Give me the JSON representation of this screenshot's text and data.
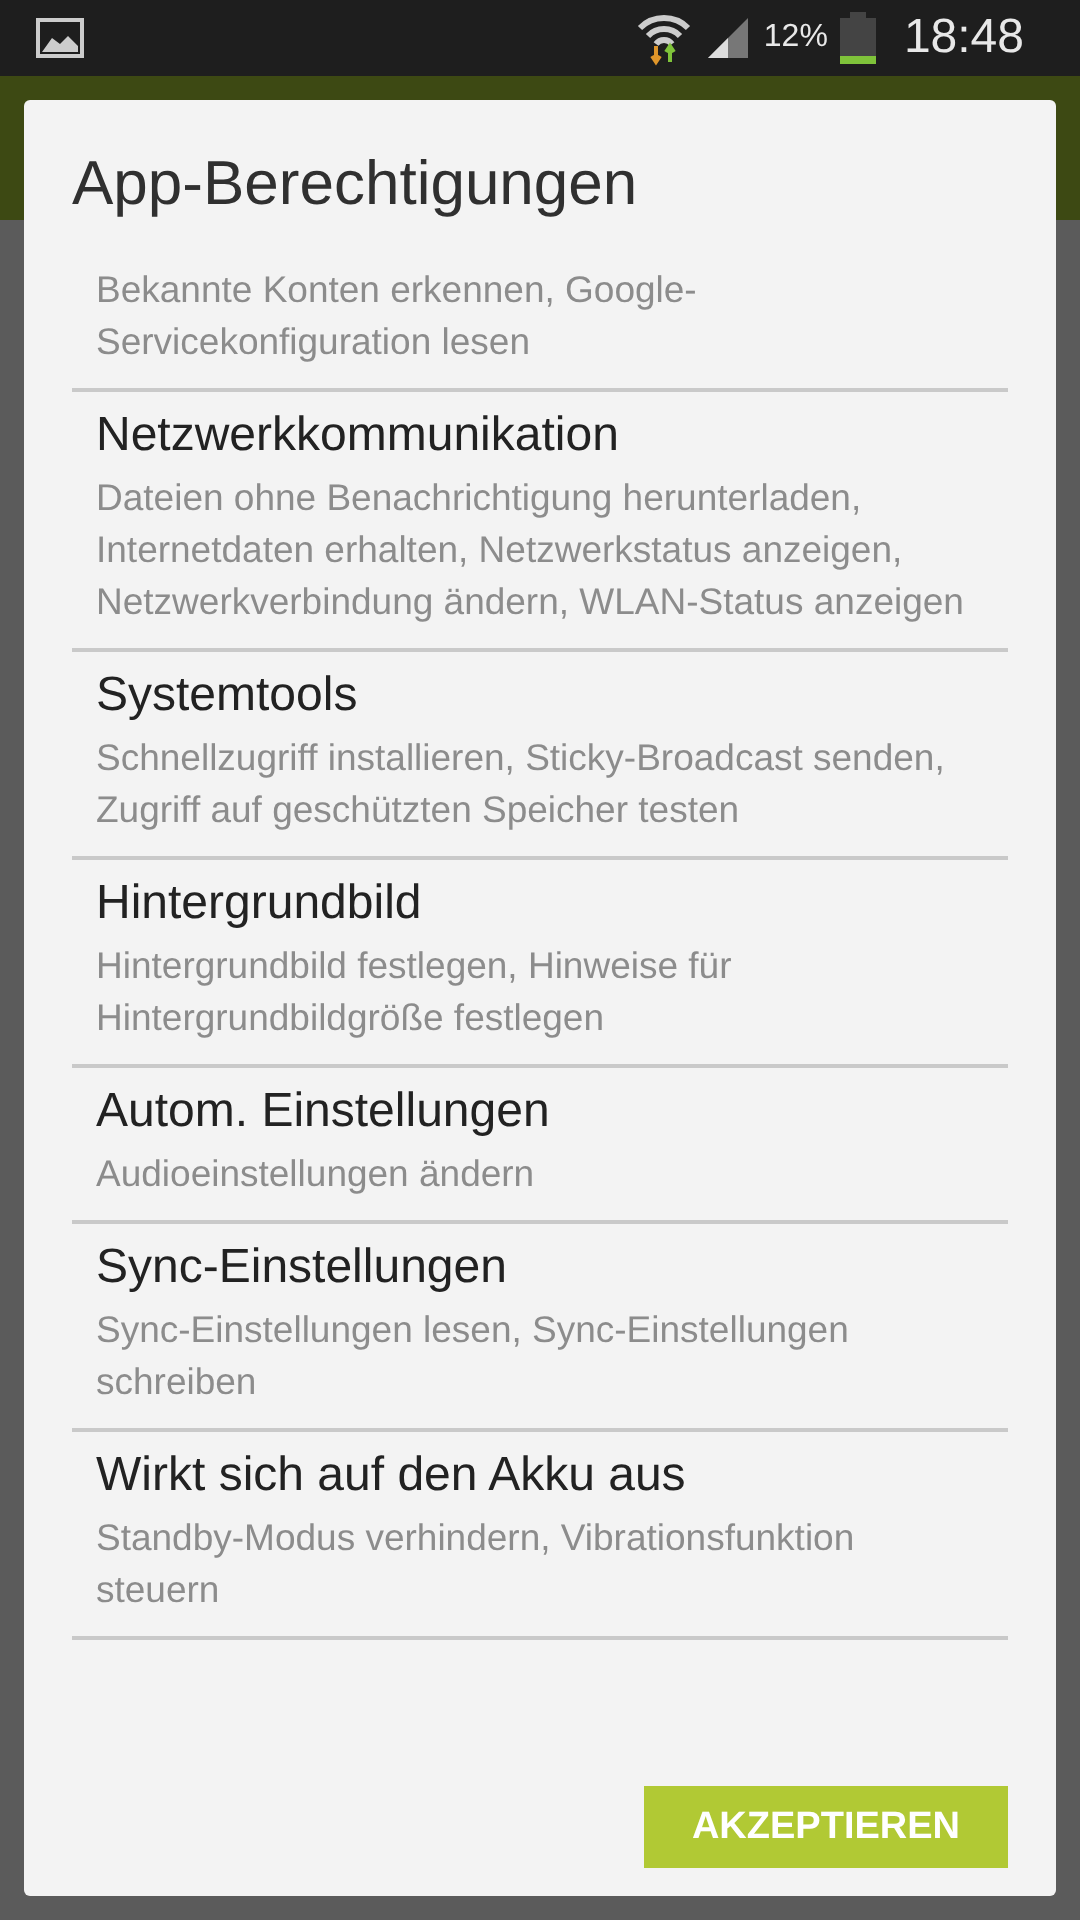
{
  "status_bar": {
    "battery_text": "12%",
    "time": "18:48"
  },
  "dialog": {
    "title": "App-Berechtigungen",
    "sections": [
      {
        "description": "Bekannte Konten erkennen, Google-Servicekonfiguration lesen"
      },
      {
        "heading": "Netzwerkkommunikation",
        "description": "Dateien ohne Benachrichtigung herunterladen, Internetdaten erhalten, Netzwerkstatus anzeigen, Netzwerkverbindung ändern, WLAN-Status anzeigen"
      },
      {
        "heading": "Systemtools",
        "description": "Schnellzugriff installieren, Sticky-Broadcast senden, Zugriff auf geschützten Speicher testen"
      },
      {
        "heading": "Hintergrundbild",
        "description": "Hintergrundbild festlegen, Hinweise für Hintergrundbildgröße festlegen"
      },
      {
        "heading": "Autom. Einstellungen",
        "description": "Audioeinstellungen ändern"
      },
      {
        "heading": "Sync-Einstellungen",
        "description": "Sync-Einstellungen lesen, Sync-Einstellungen schreiben"
      },
      {
        "heading": "Wirkt sich auf den Akku aus",
        "description": "Standby-Modus verhindern, Vibrationsfunktion steuern"
      }
    ],
    "button": "AKZEPTIEREN"
  }
}
